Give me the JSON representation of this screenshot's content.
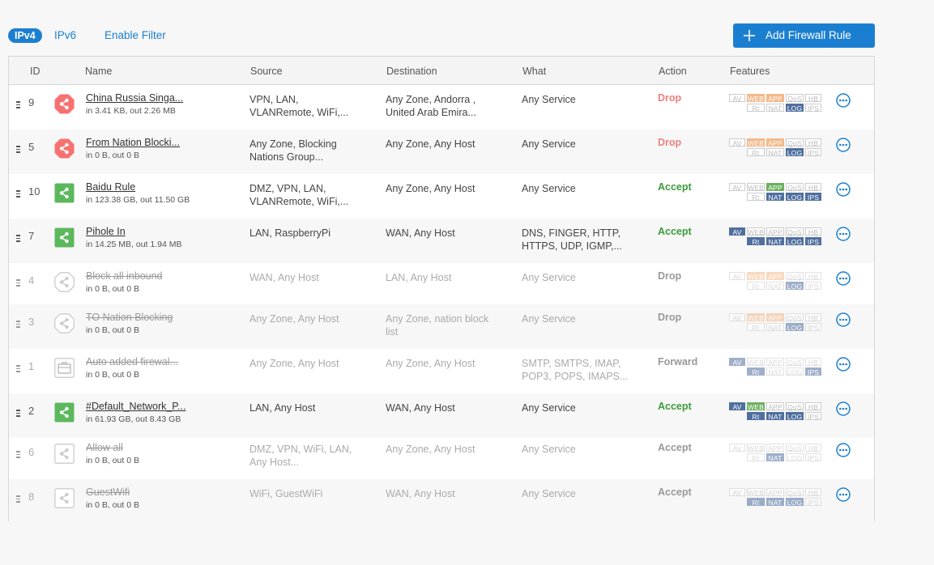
{
  "tabs": {
    "ipv4": "IPv4",
    "ipv6": "IPv6",
    "filter": "Enable Filter"
  },
  "add_button": "Add Firewall Rule",
  "headers": {
    "id": "ID",
    "name": "Name",
    "source": "Source",
    "destination": "Destination",
    "what": "What",
    "action": "Action",
    "features": "Features"
  },
  "feature_labels": [
    "AV",
    "WEB",
    "APP",
    "QoS",
    "HB",
    "Rt",
    "NAT",
    "LOG",
    "IPS"
  ],
  "colors": {
    "accent": "#1b7fd1",
    "drop": "#f08080",
    "accept": "#3d9a3d",
    "feature_on": "#4f6f9f",
    "feature_web_app": "#f3b989",
    "feature_app_green": "#6db05e",
    "drop_icon": "#f87171",
    "accept_icon": "#5cb85c"
  },
  "rules": [
    {
      "id": "9",
      "name": "China Russia Singa...",
      "stats": "in 3.41 KB, out 2.26 MB",
      "source": [
        "VPN, LAN,",
        "VLANRemote, WiFi,..."
      ],
      "destination": [
        "Any Zone, Andorra ,",
        "United Arab Emira..."
      ],
      "what": [
        "Any Service"
      ],
      "action": "Drop",
      "icon": "drop-icon",
      "disabled": false,
      "features": {
        "AV": "off",
        "WEB": "orange",
        "APP": "orange",
        "QoS": "off",
        "HB": "off",
        "Rt": "off",
        "NAT": "off",
        "LOG": "blue",
        "IPS": "off"
      }
    },
    {
      "id": "5",
      "name": "From Nation Blocki...",
      "stats": "in 0 B, out 0 B",
      "source": [
        "Any Zone, Blocking",
        "Nations Group..."
      ],
      "destination": [
        "Any Zone, Any Host"
      ],
      "what": [
        "Any Service"
      ],
      "action": "Drop",
      "icon": "drop-icon",
      "disabled": false,
      "features": {
        "AV": "off",
        "WEB": "orange",
        "APP": "orange",
        "QoS": "off",
        "HB": "off",
        "Rt": "off",
        "NAT": "off",
        "LOG": "blue",
        "IPS": "off"
      }
    },
    {
      "id": "10",
      "name": "Baidu Rule",
      "stats": "in 123.38 GB, out 11.50 GB",
      "source": [
        "DMZ, VPN, LAN,",
        "VLANRemote, WiFi,..."
      ],
      "destination": [
        "Any Zone, Any Host"
      ],
      "what": [
        "Any Service"
      ],
      "action": "Accept",
      "icon": "accept-icon",
      "disabled": false,
      "features": {
        "AV": "off",
        "WEB": "off",
        "APP": "green",
        "QoS": "off",
        "HB": "off",
        "Rt": "off",
        "NAT": "blue",
        "LOG": "blue",
        "IPS": "blue"
      }
    },
    {
      "id": "7",
      "name": "Pihole In",
      "stats": "in 14.25 MB, out 1.94 MB",
      "source": [
        "LAN, RaspberryPi"
      ],
      "destination": [
        "WAN, Any Host"
      ],
      "what": [
        "DNS, FINGER, HTTP,",
        "HTTPS, UDP, IGMP,..."
      ],
      "action": "Accept",
      "icon": "accept-icon",
      "disabled": false,
      "features": {
        "AV": "blue",
        "WEB": "off",
        "APP": "off",
        "QoS": "off",
        "HB": "off",
        "Rt": "blue",
        "NAT": "blue",
        "LOG": "blue",
        "IPS": "blue"
      }
    },
    {
      "id": "4",
      "name": "Block all inbound",
      "stats": "in 0 B, out 0 B",
      "source": [
        "WAN, Any Host"
      ],
      "destination": [
        "LAN, Any Host"
      ],
      "what": [
        "Any Service"
      ],
      "action": "Drop",
      "icon": "disabled-drop-icon",
      "disabled": true,
      "features": {
        "AV": "off",
        "WEB": "orange",
        "APP": "orange",
        "QoS": "off",
        "HB": "off",
        "Rt": "off",
        "NAT": "off",
        "LOG": "blue",
        "IPS": "off"
      }
    },
    {
      "id": "3",
      "name": "TO Nation Blocking",
      "stats": "in 0 B, out 0 B",
      "source": [
        "Any Zone, Any Host"
      ],
      "destination": [
        "Any Zone, nation block",
        "list"
      ],
      "what": [
        "Any Service"
      ],
      "action": "Drop",
      "icon": "disabled-drop-icon",
      "disabled": true,
      "features": {
        "AV": "off",
        "WEB": "orange",
        "APP": "orange",
        "QoS": "off",
        "HB": "off",
        "Rt": "off",
        "NAT": "off",
        "LOG": "blue",
        "IPS": "off"
      }
    },
    {
      "id": "1",
      "name": "Auto added firewal...",
      "stats": "in 0 B, out 0 B",
      "source": [
        "Any Zone, Any Host"
      ],
      "destination": [
        "Any Zone, Any Host"
      ],
      "what": [
        "SMTP, SMTPS, IMAP,",
        "POP3, POPS, IMAPS..."
      ],
      "action": "Forward",
      "icon": "forward-icon",
      "disabled": true,
      "features": {
        "AV": "blue",
        "WEB": "off",
        "APP": "off",
        "QoS": "off",
        "HB": "off",
        "Rt": "blue",
        "NAT": "off",
        "LOG": "off",
        "IPS": "blue"
      }
    },
    {
      "id": "2",
      "name": "#Default_Network_P...",
      "stats": "in 61.93 GB, out 8.43 GB",
      "source": [
        "LAN, Any Host"
      ],
      "destination": [
        "WAN, Any Host"
      ],
      "what": [
        "Any Service"
      ],
      "action": "Accept",
      "icon": "accept-icon",
      "disabled": false,
      "features": {
        "AV": "blue",
        "WEB": "green",
        "APP": "off",
        "QoS": "off",
        "HB": "off",
        "Rt": "blue",
        "NAT": "blue",
        "LOG": "blue",
        "IPS": "off"
      }
    },
    {
      "id": "6",
      "name": "Allow all",
      "stats": "in 0 B, out 0 B",
      "source": [
        "DMZ, VPN, WiFi, LAN,",
        "Any Host..."
      ],
      "destination": [
        "Any Zone, Any Host"
      ],
      "what": [
        "Any Service"
      ],
      "action": "Accept",
      "icon": "disabled-accept-icon",
      "disabled": true,
      "features": {
        "AV": "off",
        "WEB": "off",
        "APP": "off",
        "QoS": "off",
        "HB": "off",
        "Rt": "off",
        "NAT": "blue",
        "LOG": "off",
        "IPS": "off"
      }
    },
    {
      "id": "8",
      "name": "GuestWifi",
      "stats": "in 0 B, out 0 B",
      "source": [
        "WiFi, GuestWiFi"
      ],
      "destination": [
        "WAN, Any Host"
      ],
      "what": [
        "Any Service"
      ],
      "action": "Accept",
      "icon": "disabled-accept-icon",
      "disabled": true,
      "features": {
        "AV": "off",
        "WEB": "off",
        "APP": "off",
        "QoS": "off",
        "HB": "off",
        "Rt": "blue",
        "NAT": "blue",
        "LOG": "blue",
        "IPS": "off"
      }
    }
  ]
}
